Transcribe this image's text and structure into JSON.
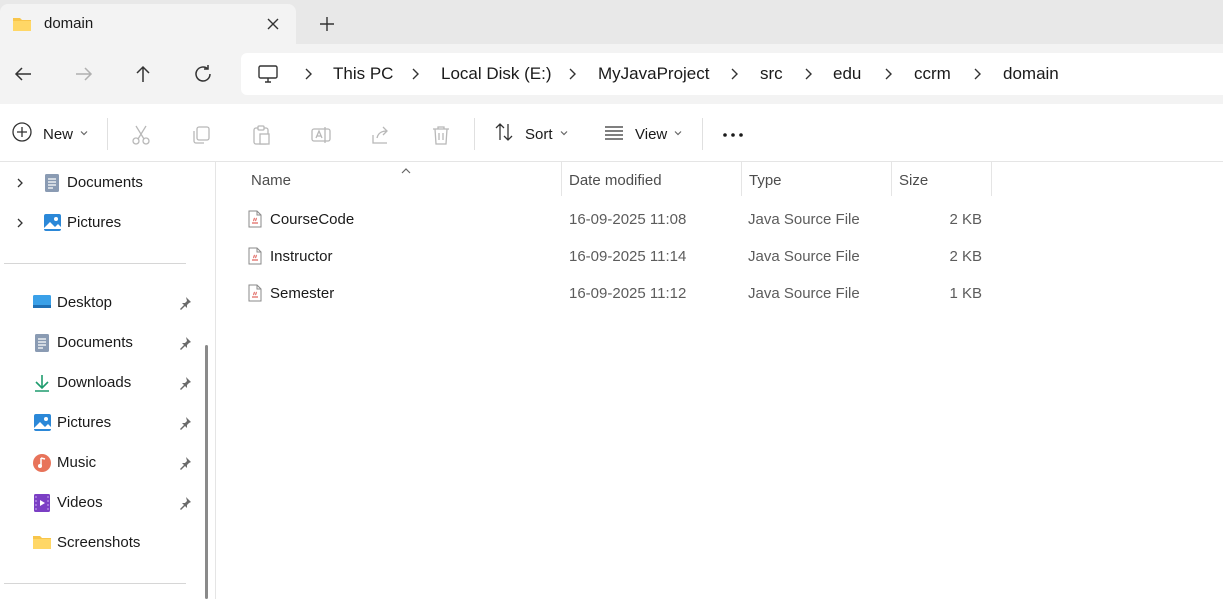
{
  "tab": {
    "title": "domain"
  },
  "breadcrumb": [
    "This PC",
    "Local Disk (E:)",
    "MyJavaProject",
    "src",
    "edu",
    "ccrm",
    "domain"
  ],
  "toolbar": {
    "new_label": "New",
    "sort_label": "Sort",
    "view_label": "View"
  },
  "sidebar": {
    "tree": [
      {
        "label": "Documents",
        "icon": "documents-icon"
      },
      {
        "label": "Pictures",
        "icon": "pictures-icon"
      }
    ],
    "quick_access": [
      {
        "label": "Desktop",
        "icon": "desktop-icon",
        "pinned": true
      },
      {
        "label": "Documents",
        "icon": "documents-icon",
        "pinned": true
      },
      {
        "label": "Downloads",
        "icon": "downloads-icon",
        "pinned": true
      },
      {
        "label": "Pictures",
        "icon": "pictures-icon",
        "pinned": true
      },
      {
        "label": "Music",
        "icon": "music-icon",
        "pinned": true
      },
      {
        "label": "Videos",
        "icon": "videos-icon",
        "pinned": true
      },
      {
        "label": "Screenshots",
        "icon": "folder-icon",
        "pinned": false
      }
    ]
  },
  "columns": {
    "name": "Name",
    "date": "Date modified",
    "type": "Type",
    "size": "Size"
  },
  "files": [
    {
      "name": "CourseCode",
      "date": "16-09-2025 11:08",
      "type": "Java Source File",
      "size": "2 KB"
    },
    {
      "name": "Instructor",
      "date": "16-09-2025 11:14",
      "type": "Java Source File",
      "size": "2 KB"
    },
    {
      "name": "Semester",
      "date": "16-09-2025 11:12",
      "type": "Java Source File",
      "size": "1 KB"
    }
  ],
  "colors": {
    "folder": "#f8c54a",
    "accent": "#0067c0",
    "disabled": "#b8b8b8"
  }
}
